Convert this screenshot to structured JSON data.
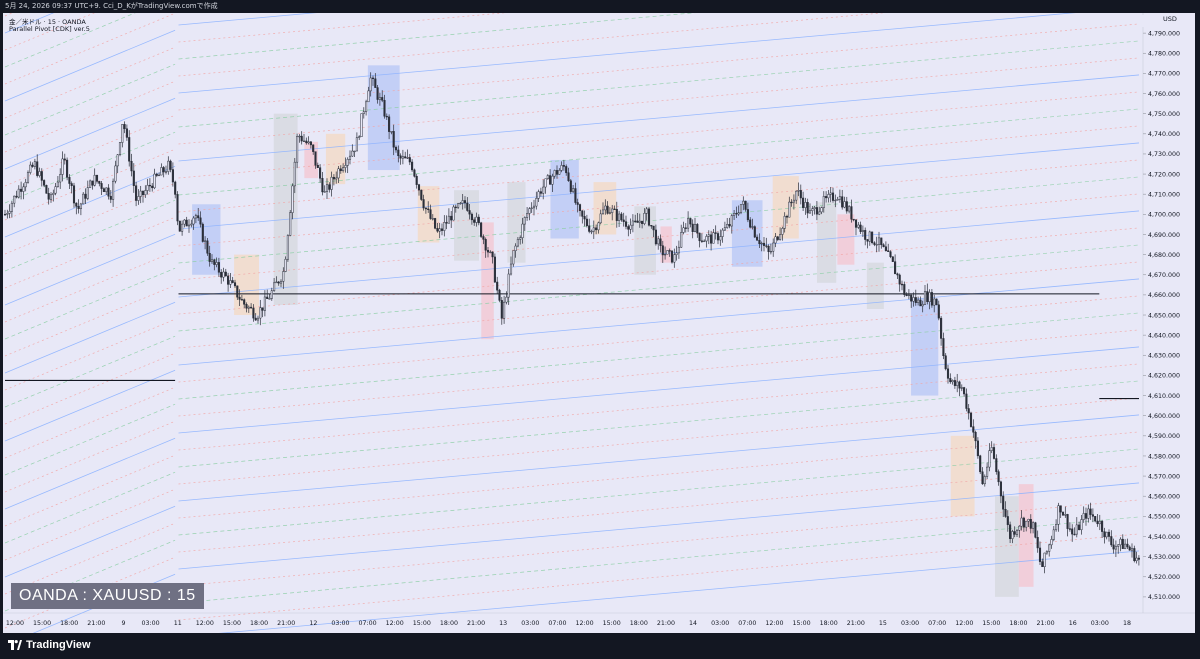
{
  "header": {
    "text": "5月 24, 2026 09:37 UTC+9.  Cci_D_KがTradingView.comで作成"
  },
  "legend": {
    "symbol_line": "金／米ドル · 15 · OANDA",
    "indicator_line": "Parallel Pivot [CDK] ver.5"
  },
  "price_axis": {
    "currency": "USD"
  },
  "watermark": "OANDA : XAUUSD : 15",
  "footer": {
    "brand": "TradingView"
  },
  "colors": {
    "background": "#e8e8f7",
    "frame": "#131722",
    "candle": "#2a2e39",
    "blue_line": "#8fb4ff",
    "red_dotted": "#f2a5a5",
    "green_dashed": "#8fcfa8",
    "box_blue": "#b9c8f5",
    "box_orange": "#f3d9c6",
    "box_gray": "#d6d8de",
    "box_pink": "#f2c7d2"
  },
  "chart_data": {
    "type": "candlestick",
    "symbol": "XAUUSD",
    "timeframe": "15",
    "ylim": [
      4502,
      4800
    ],
    "y_ticks": [
      4510,
      4520,
      4530,
      4540,
      4550,
      4560,
      4570,
      4580,
      4590,
      4600,
      4610,
      4620,
      4630,
      4640,
      4650,
      4660,
      4670,
      4680,
      4690,
      4700,
      4710,
      4720,
      4730,
      4740,
      4750,
      4760,
      4770,
      4780,
      4790
    ],
    "y_tick_labels": [
      "4,510.000",
      "4,520.000",
      "4,530.000",
      "4,540.000",
      "4,550.000",
      "4,560.000",
      "4,570.000",
      "4,580.000",
      "4,590.000",
      "4,600.000",
      "4,610.000",
      "4,620.000",
      "4,630.000",
      "4,640.000",
      "4,650.000",
      "4,660.000",
      "4,670.000",
      "4,680.000",
      "4,690.000",
      "4,700.000",
      "4,710.000",
      "4,720.000",
      "4,730.000",
      "4,740.000",
      "4,750.000",
      "4,760.000",
      "4,770.000",
      "4,780.000",
      "4,790.000"
    ],
    "x_tick_labels": [
      "12:00",
      "15:00",
      "18:00",
      "21:00",
      "9",
      "03:00",
      "11",
      "12:00",
      "15:00",
      "18:00",
      "21:00",
      "12",
      "03:00",
      "07:00",
      "12:00",
      "15:00",
      "18:00",
      "21:00",
      "13",
      "03:00",
      "07:00",
      "12:00",
      "15:00",
      "18:00",
      "21:00",
      "14",
      "03:00",
      "07:00",
      "12:00",
      "15:00",
      "18:00",
      "21:00",
      "15",
      "03:00",
      "07:00",
      "12:00",
      "15:00",
      "18:00",
      "21:00",
      "16",
      "03:00",
      "18"
    ],
    "price_path": [
      {
        "x": 0.0,
        "p": 4700
      },
      {
        "x": 0.012,
        "p": 4712
      },
      {
        "x": 0.026,
        "p": 4725
      },
      {
        "x": 0.04,
        "p": 4706
      },
      {
        "x": 0.052,
        "p": 4727
      },
      {
        "x": 0.064,
        "p": 4702
      },
      {
        "x": 0.078,
        "p": 4718
      },
      {
        "x": 0.094,
        "p": 4710
      },
      {
        "x": 0.104,
        "p": 4748
      },
      {
        "x": 0.116,
        "p": 4706
      },
      {
        "x": 0.13,
        "p": 4716
      },
      {
        "x": 0.144,
        "p": 4724
      },
      {
        "x": 0.15,
        "p": 4713
      },
      {
        "x": 0.153,
        "p": 4692
      },
      {
        "x": 0.168,
        "p": 4700
      },
      {
        "x": 0.182,
        "p": 4676
      },
      {
        "x": 0.196,
        "p": 4668
      },
      {
        "x": 0.21,
        "p": 4656
      },
      {
        "x": 0.222,
        "p": 4650
      },
      {
        "x": 0.234,
        "p": 4660
      },
      {
        "x": 0.246,
        "p": 4672
      },
      {
        "x": 0.258,
        "p": 4740
      },
      {
        "x": 0.27,
        "p": 4733
      },
      {
        "x": 0.282,
        "p": 4710
      },
      {
        "x": 0.296,
        "p": 4724
      },
      {
        "x": 0.31,
        "p": 4735
      },
      {
        "x": 0.322,
        "p": 4768
      },
      {
        "x": 0.334,
        "p": 4752
      },
      {
        "x": 0.346,
        "p": 4728
      },
      {
        "x": 0.358,
        "p": 4726
      },
      {
        "x": 0.37,
        "p": 4704
      },
      {
        "x": 0.382,
        "p": 4690
      },
      {
        "x": 0.394,
        "p": 4700
      },
      {
        "x": 0.406,
        "p": 4706
      },
      {
        "x": 0.418,
        "p": 4694
      },
      {
        "x": 0.43,
        "p": 4676
      },
      {
        "x": 0.438,
        "p": 4648
      },
      {
        "x": 0.448,
        "p": 4680
      },
      {
        "x": 0.46,
        "p": 4700
      },
      {
        "x": 0.472,
        "p": 4712
      },
      {
        "x": 0.484,
        "p": 4720
      },
      {
        "x": 0.494,
        "p": 4724
      },
      {
        "x": 0.506,
        "p": 4700
      },
      {
        "x": 0.518,
        "p": 4692
      },
      {
        "x": 0.53,
        "p": 4704
      },
      {
        "x": 0.542,
        "p": 4698
      },
      {
        "x": 0.554,
        "p": 4694
      },
      {
        "x": 0.566,
        "p": 4700
      },
      {
        "x": 0.578,
        "p": 4682
      },
      {
        "x": 0.59,
        "p": 4678
      },
      {
        "x": 0.602,
        "p": 4698
      },
      {
        "x": 0.614,
        "p": 4688
      },
      {
        "x": 0.626,
        "p": 4688
      },
      {
        "x": 0.638,
        "p": 4694
      },
      {
        "x": 0.65,
        "p": 4706
      },
      {
        "x": 0.662,
        "p": 4690
      },
      {
        "x": 0.674,
        "p": 4680
      },
      {
        "x": 0.686,
        "p": 4696
      },
      {
        "x": 0.698,
        "p": 4712
      },
      {
        "x": 0.71,
        "p": 4700
      },
      {
        "x": 0.722,
        "p": 4706
      },
      {
        "x": 0.734,
        "p": 4710
      },
      {
        "x": 0.746,
        "p": 4700
      },
      {
        "x": 0.758,
        "p": 4690
      },
      {
        "x": 0.77,
        "p": 4686
      },
      {
        "x": 0.782,
        "p": 4676
      },
      {
        "x": 0.794,
        "p": 4660
      },
      {
        "x": 0.806,
        "p": 4656
      },
      {
        "x": 0.812,
        "p": 4660
      },
      {
        "x": 0.822,
        "p": 4656
      },
      {
        "x": 0.828,
        "p": 4628
      },
      {
        "x": 0.834,
        "p": 4616
      },
      {
        "x": 0.844,
        "p": 4614
      },
      {
        "x": 0.854,
        "p": 4592
      },
      {
        "x": 0.862,
        "p": 4566
      },
      {
        "x": 0.87,
        "p": 4584
      },
      {
        "x": 0.878,
        "p": 4562
      },
      {
        "x": 0.886,
        "p": 4540
      },
      {
        "x": 0.896,
        "p": 4548
      },
      {
        "x": 0.906,
        "p": 4546
      },
      {
        "x": 0.914,
        "p": 4524
      },
      {
        "x": 0.922,
        "p": 4538
      },
      {
        "x": 0.93,
        "p": 4556
      },
      {
        "x": 0.942,
        "p": 4540
      },
      {
        "x": 0.954,
        "p": 4552
      },
      {
        "x": 0.964,
        "p": 4548
      },
      {
        "x": 0.976,
        "p": 4536
      },
      {
        "x": 0.988,
        "p": 4536
      },
      {
        "x": 1.0,
        "p": 4528
      }
    ],
    "horizontal_levels": [
      {
        "p": 4617.5,
        "x_start": 0.0,
        "x_end": 0.15
      },
      {
        "p": 4660.5,
        "x_start": 0.153,
        "x_end": 0.965
      },
      {
        "p": 4608.5,
        "x_start": 0.965,
        "x_end": 1.0
      }
    ],
    "session_boxes": [
      {
        "x0": 0.165,
        "x1": 0.19,
        "p0": 4670,
        "p1": 4705,
        "kind": "blue"
      },
      {
        "x0": 0.202,
        "x1": 0.224,
        "p0": 4650,
        "p1": 4680,
        "kind": "orange"
      },
      {
        "x0": 0.237,
        "x1": 0.258,
        "p0": 4655,
        "p1": 4750,
        "kind": "gray"
      },
      {
        "x0": 0.264,
        "x1": 0.276,
        "p0": 4718,
        "p1": 4736,
        "kind": "pink"
      },
      {
        "x0": 0.283,
        "x1": 0.3,
        "p0": 4715,
        "p1": 4740,
        "kind": "orange"
      },
      {
        "x0": 0.32,
        "x1": 0.348,
        "p0": 4722,
        "p1": 4774,
        "kind": "blue"
      },
      {
        "x0": 0.364,
        "x1": 0.383,
        "p0": 4686,
        "p1": 4714,
        "kind": "orange"
      },
      {
        "x0": 0.396,
        "x1": 0.418,
        "p0": 4677,
        "p1": 4712,
        "kind": "gray"
      },
      {
        "x0": 0.42,
        "x1": 0.431,
        "p0": 4638,
        "p1": 4696,
        "kind": "pink"
      },
      {
        "x0": 0.443,
        "x1": 0.459,
        "p0": 4676,
        "p1": 4716,
        "kind": "gray"
      },
      {
        "x0": 0.481,
        "x1": 0.506,
        "p0": 4688,
        "p1": 4727,
        "kind": "blue"
      },
      {
        "x0": 0.519,
        "x1": 0.539,
        "p0": 4690,
        "p1": 4716,
        "kind": "orange"
      },
      {
        "x0": 0.555,
        "x1": 0.574,
        "p0": 4670,
        "p1": 4704,
        "kind": "gray"
      },
      {
        "x0": 0.578,
        "x1": 0.588,
        "p0": 4676,
        "p1": 4694,
        "kind": "pink"
      },
      {
        "x0": 0.641,
        "x1": 0.668,
        "p0": 4674,
        "p1": 4707,
        "kind": "blue"
      },
      {
        "x0": 0.677,
        "x1": 0.7,
        "p0": 4688,
        "p1": 4719,
        "kind": "orange"
      },
      {
        "x0": 0.716,
        "x1": 0.733,
        "p0": 4666,
        "p1": 4706,
        "kind": "gray"
      },
      {
        "x0": 0.734,
        "x1": 0.749,
        "p0": 4675,
        "p1": 4700,
        "kind": "pink"
      },
      {
        "x0": 0.76,
        "x1": 0.775,
        "p0": 4653,
        "p1": 4676,
        "kind": "gray"
      },
      {
        "x0": 0.799,
        "x1": 0.823,
        "p0": 4610,
        "p1": 4658,
        "kind": "blue"
      },
      {
        "x0": 0.834,
        "x1": 0.855,
        "p0": 4550,
        "p1": 4590,
        "kind": "orange"
      },
      {
        "x0": 0.873,
        "x1": 0.894,
        "p0": 4510,
        "p1": 4560,
        "kind": "gray"
      },
      {
        "x0": 0.894,
        "x1": 0.907,
        "p0": 4515,
        "p1": 4566,
        "kind": "pink"
      }
    ]
  }
}
